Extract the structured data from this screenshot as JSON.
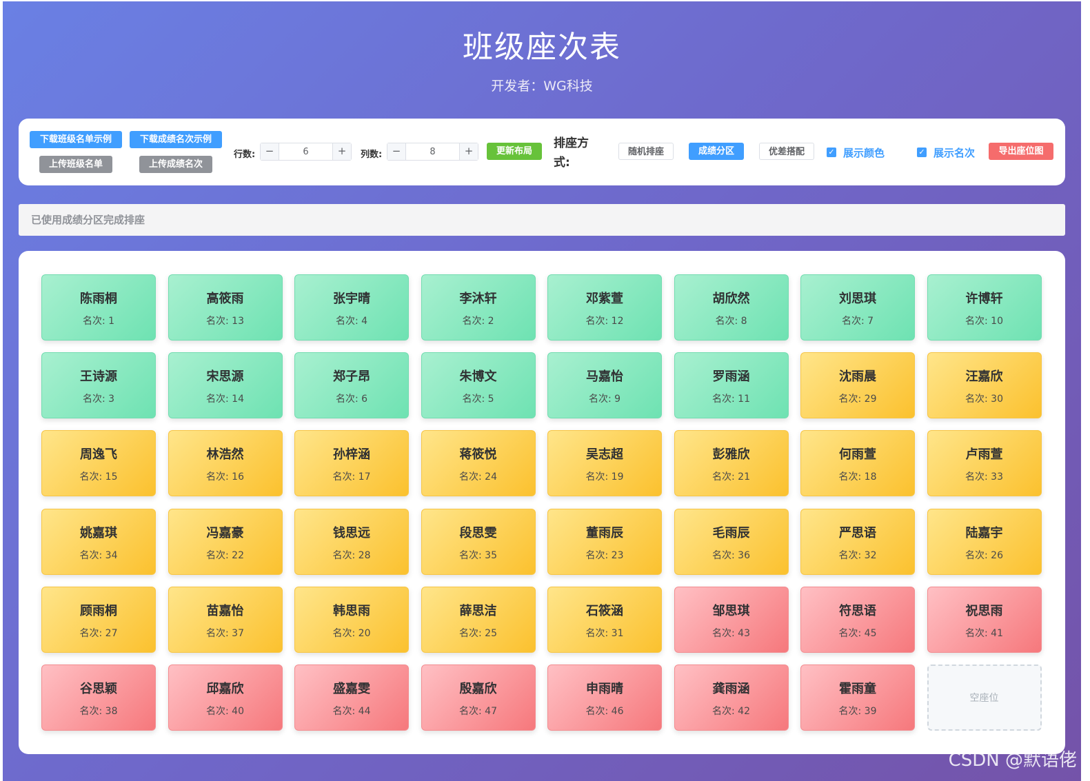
{
  "header": {
    "title": "班级座次表",
    "subtitle": "开发者：WG科技"
  },
  "toolbar": {
    "download_roster_sample": "下载班级名单示例",
    "download_scores_sample": "下载成绩名次示例",
    "upload_roster": "上传班级名单",
    "upload_scores": "上传成绩名次",
    "rows_label": "行数:",
    "rows_value": "6",
    "cols_label": "列数:",
    "cols_value": "8",
    "update_layout": "更新布局",
    "mode_label": "排座方式:",
    "mode_random": "随机排座",
    "mode_score": "成绩分区",
    "mode_pair": "优差搭配",
    "show_color": "展示颜色",
    "show_rank": "展示名次",
    "export": "导出座位图",
    "minus": "−",
    "plus": "+",
    "check": "✓"
  },
  "status": {
    "message": "已使用成绩分区完成排座"
  },
  "seats": {
    "rank_prefix": "名次: ",
    "empty_label": "空座位",
    "items": [
      {
        "name": "陈雨桐",
        "rank": "名次: 1",
        "tier": "green"
      },
      {
        "name": "高筱雨",
        "rank": "名次: 13",
        "tier": "green"
      },
      {
        "name": "张宇晴",
        "rank": "名次: 4",
        "tier": "green"
      },
      {
        "name": "李沐轩",
        "rank": "名次: 2",
        "tier": "green"
      },
      {
        "name": "邓紫萱",
        "rank": "名次: 12",
        "tier": "green"
      },
      {
        "name": "胡欣然",
        "rank": "名次: 8",
        "tier": "green"
      },
      {
        "name": "刘思琪",
        "rank": "名次: 7",
        "tier": "green"
      },
      {
        "name": "许博轩",
        "rank": "名次: 10",
        "tier": "green"
      },
      {
        "name": "王诗源",
        "rank": "名次: 3",
        "tier": "green"
      },
      {
        "name": "宋思源",
        "rank": "名次: 14",
        "tier": "green"
      },
      {
        "name": "郑子昂",
        "rank": "名次: 6",
        "tier": "green"
      },
      {
        "name": "朱博文",
        "rank": "名次: 5",
        "tier": "green"
      },
      {
        "name": "马嘉怡",
        "rank": "名次: 9",
        "tier": "green"
      },
      {
        "name": "罗雨涵",
        "rank": "名次: 11",
        "tier": "green"
      },
      {
        "name": "沈雨晨",
        "rank": "名次: 29",
        "tier": "yellow"
      },
      {
        "name": "汪嘉欣",
        "rank": "名次: 30",
        "tier": "yellow"
      },
      {
        "name": "周逸飞",
        "rank": "名次: 15",
        "tier": "yellow"
      },
      {
        "name": "林浩然",
        "rank": "名次: 16",
        "tier": "yellow"
      },
      {
        "name": "孙梓涵",
        "rank": "名次: 17",
        "tier": "yellow"
      },
      {
        "name": "蒋筱悦",
        "rank": "名次: 24",
        "tier": "yellow"
      },
      {
        "name": "吴志超",
        "rank": "名次: 19",
        "tier": "yellow"
      },
      {
        "name": "彭雅欣",
        "rank": "名次: 21",
        "tier": "yellow"
      },
      {
        "name": "何雨萱",
        "rank": "名次: 18",
        "tier": "yellow"
      },
      {
        "name": "卢雨萱",
        "rank": "名次: 33",
        "tier": "yellow"
      },
      {
        "name": "姚嘉琪",
        "rank": "名次: 34",
        "tier": "yellow"
      },
      {
        "name": "冯嘉豪",
        "rank": "名次: 22",
        "tier": "yellow"
      },
      {
        "name": "钱思远",
        "rank": "名次: 28",
        "tier": "yellow"
      },
      {
        "name": "段思雯",
        "rank": "名次: 35",
        "tier": "yellow"
      },
      {
        "name": "董雨辰",
        "rank": "名次: 23",
        "tier": "yellow"
      },
      {
        "name": "毛雨辰",
        "rank": "名次: 36",
        "tier": "yellow"
      },
      {
        "name": "严思语",
        "rank": "名次: 32",
        "tier": "yellow"
      },
      {
        "name": "陆嘉宇",
        "rank": "名次: 26",
        "tier": "yellow"
      },
      {
        "name": "顾雨桐",
        "rank": "名次: 27",
        "tier": "yellow"
      },
      {
        "name": "苗嘉怡",
        "rank": "名次: 37",
        "tier": "yellow"
      },
      {
        "name": "韩思雨",
        "rank": "名次: 20",
        "tier": "yellow"
      },
      {
        "name": "薛思洁",
        "rank": "名次: 25",
        "tier": "yellow"
      },
      {
        "name": "石筱涵",
        "rank": "名次: 31",
        "tier": "yellow"
      },
      {
        "name": "邹思琪",
        "rank": "名次: 43",
        "tier": "red"
      },
      {
        "name": "符思语",
        "rank": "名次: 45",
        "tier": "red"
      },
      {
        "name": "祝思雨",
        "rank": "名次: 41",
        "tier": "red"
      },
      {
        "name": "谷思颖",
        "rank": "名次: 38",
        "tier": "red"
      },
      {
        "name": "邱嘉欣",
        "rank": "名次: 40",
        "tier": "red"
      },
      {
        "name": "盛嘉雯",
        "rank": "名次: 44",
        "tier": "red"
      },
      {
        "name": "殷嘉欣",
        "rank": "名次: 47",
        "tier": "red"
      },
      {
        "name": "申雨晴",
        "rank": "名次: 46",
        "tier": "red"
      },
      {
        "name": "龚雨涵",
        "rank": "名次: 42",
        "tier": "red"
      },
      {
        "name": "霍雨童",
        "rank": "名次: 39",
        "tier": "red"
      },
      {
        "name": "",
        "rank": "",
        "tier": "empty"
      }
    ]
  },
  "watermark": "CSDN @默语佬",
  "colors": {
    "primary": "#409eff",
    "success": "#67c23a",
    "danger": "#f56c6c",
    "tier_green": "#6ee2b2",
    "tier_yellow": "#fbc12e",
    "tier_red": "#f6787c"
  }
}
